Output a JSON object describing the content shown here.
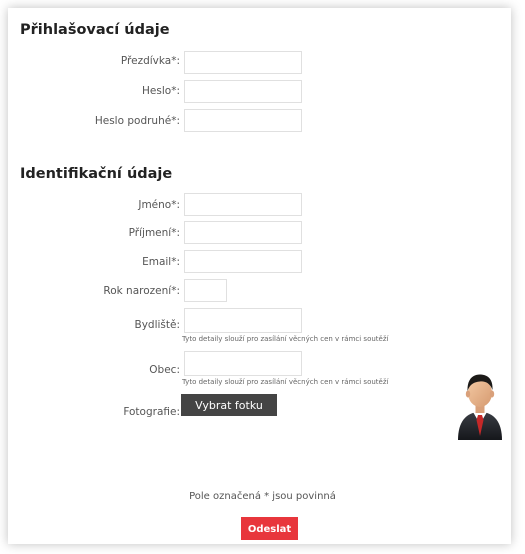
{
  "login_section": {
    "title": "Přihlašovací údaje",
    "nickname_label": "Přezdívka*:",
    "password_label": "Heslo*:",
    "password_repeat_label": "Heslo podruhé*:"
  },
  "identity_section": {
    "title": "Identifikační údaje",
    "first_name_label": "Jméno*:",
    "last_name_label": "Příjmení*:",
    "email_label": "Email*:",
    "birth_year_label": "Rok narození*:",
    "address_label": "Bydliště:",
    "address_hint": "Tyto detaily slouží pro zasílání věcných cen v rámci soutěží",
    "city_label": "Obec:",
    "city_hint": "Tyto detaily slouží pro zasílání věcných cen v rámci soutěží",
    "photo_label": "Fotografie:",
    "photo_button": "Vybrat fotku"
  },
  "avatar_icon": "user-avatar-icon",
  "required_note": "Pole označená * jsou povinná",
  "submit_button": "Odeslat",
  "colors": {
    "submit_bg": "#e8363c",
    "photo_button_bg": "#444444",
    "section_title": "#222222",
    "label": "#555555"
  }
}
